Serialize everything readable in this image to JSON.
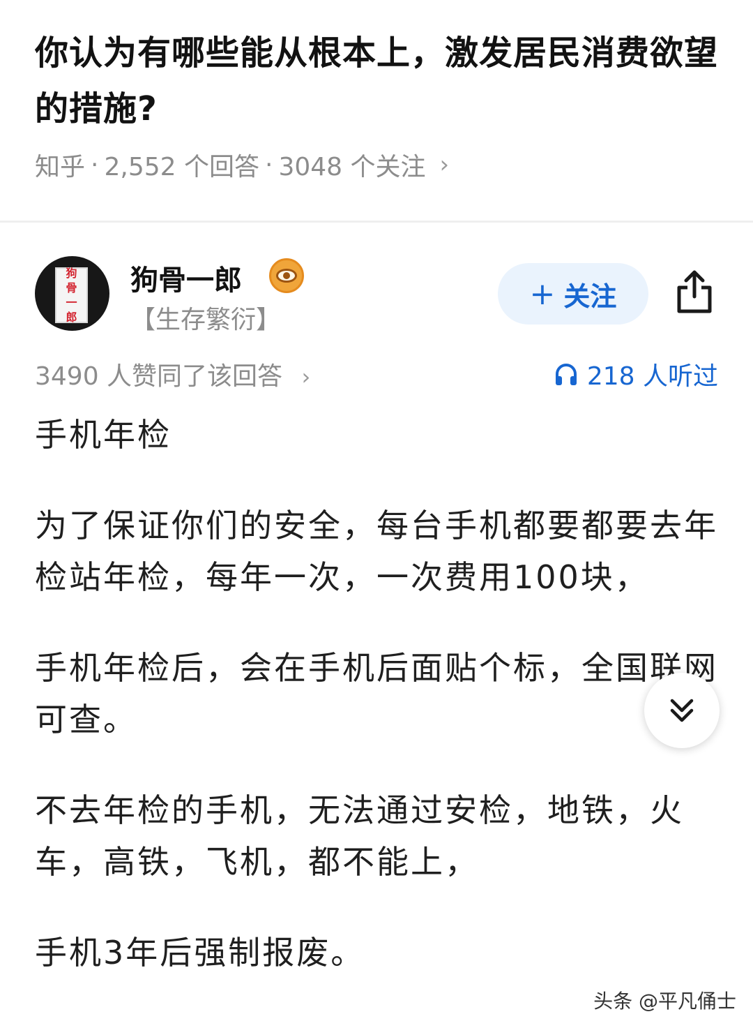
{
  "question": {
    "title": "你认为有哪些能从根本上，激发居民消费欲望的措施?",
    "source": "知乎",
    "answers": "2,552 个回答",
    "followers": "3048 个关注",
    "chevron": "›"
  },
  "author": {
    "name": "狗骨一郎",
    "avatar_text": [
      "狗",
      "骨",
      "一",
      "郎"
    ],
    "signature": "【生存繁衍】",
    "follow_label": "关注",
    "follow_plus": "+"
  },
  "stats": {
    "agree": "3490 人赞同了该回答",
    "agree_chevron": "›",
    "listened": "218 人听过"
  },
  "content": {
    "paragraphs": [
      "手机年检",
      "为了保证你们的安全，每台手机都要都要去年检站年检，每年一次，一次费用100块，",
      "手机年检后，会在手机后面贴个标，全国联网可查。",
      "不去年检的手机，无法通过安检，地铁，火车，高铁，飞机，都不能上，",
      "手机3年后强制报废。"
    ]
  },
  "watermark": "头条 @平凡俑士",
  "colors": {
    "accent": "#1766d1",
    "follow_bg": "#eaf3fd",
    "meta_gray": "#8c8c8c"
  },
  "icons": {
    "share": "share-icon",
    "headphones": "headphones-icon",
    "scroll": "double-chevron-down-icon",
    "badge": "eye-badge-icon"
  }
}
